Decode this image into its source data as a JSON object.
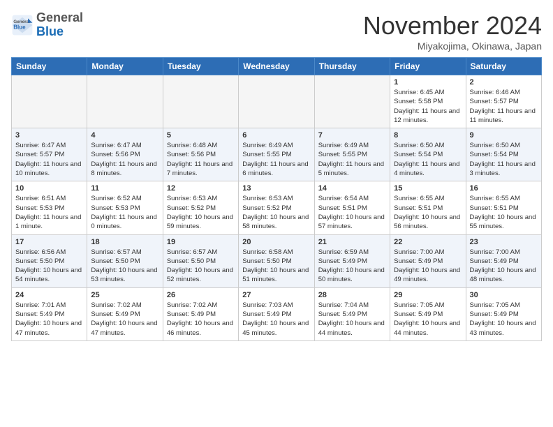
{
  "header": {
    "logo": {
      "general": "General",
      "blue": "Blue"
    },
    "title": "November 2024",
    "location": "Miyakojima, Okinawa, Japan"
  },
  "weekdays": [
    "Sunday",
    "Monday",
    "Tuesday",
    "Wednesday",
    "Thursday",
    "Friday",
    "Saturday"
  ],
  "weeks": [
    [
      {
        "day": null
      },
      {
        "day": null
      },
      {
        "day": null
      },
      {
        "day": null
      },
      {
        "day": null
      },
      {
        "day": 1,
        "sunrise": "Sunrise: 6:45 AM",
        "sunset": "Sunset: 5:58 PM",
        "daylight": "Daylight: 11 hours and 12 minutes."
      },
      {
        "day": 2,
        "sunrise": "Sunrise: 6:46 AM",
        "sunset": "Sunset: 5:57 PM",
        "daylight": "Daylight: 11 hours and 11 minutes."
      }
    ],
    [
      {
        "day": 3,
        "sunrise": "Sunrise: 6:47 AM",
        "sunset": "Sunset: 5:57 PM",
        "daylight": "Daylight: 11 hours and 10 minutes."
      },
      {
        "day": 4,
        "sunrise": "Sunrise: 6:47 AM",
        "sunset": "Sunset: 5:56 PM",
        "daylight": "Daylight: 11 hours and 8 minutes."
      },
      {
        "day": 5,
        "sunrise": "Sunrise: 6:48 AM",
        "sunset": "Sunset: 5:56 PM",
        "daylight": "Daylight: 11 hours and 7 minutes."
      },
      {
        "day": 6,
        "sunrise": "Sunrise: 6:49 AM",
        "sunset": "Sunset: 5:55 PM",
        "daylight": "Daylight: 11 hours and 6 minutes."
      },
      {
        "day": 7,
        "sunrise": "Sunrise: 6:49 AM",
        "sunset": "Sunset: 5:55 PM",
        "daylight": "Daylight: 11 hours and 5 minutes."
      },
      {
        "day": 8,
        "sunrise": "Sunrise: 6:50 AM",
        "sunset": "Sunset: 5:54 PM",
        "daylight": "Daylight: 11 hours and 4 minutes."
      },
      {
        "day": 9,
        "sunrise": "Sunrise: 6:50 AM",
        "sunset": "Sunset: 5:54 PM",
        "daylight": "Daylight: 11 hours and 3 minutes."
      }
    ],
    [
      {
        "day": 10,
        "sunrise": "Sunrise: 6:51 AM",
        "sunset": "Sunset: 5:53 PM",
        "daylight": "Daylight: 11 hours and 1 minute."
      },
      {
        "day": 11,
        "sunrise": "Sunrise: 6:52 AM",
        "sunset": "Sunset: 5:53 PM",
        "daylight": "Daylight: 11 hours and 0 minutes."
      },
      {
        "day": 12,
        "sunrise": "Sunrise: 6:53 AM",
        "sunset": "Sunset: 5:52 PM",
        "daylight": "Daylight: 10 hours and 59 minutes."
      },
      {
        "day": 13,
        "sunrise": "Sunrise: 6:53 AM",
        "sunset": "Sunset: 5:52 PM",
        "daylight": "Daylight: 10 hours and 58 minutes."
      },
      {
        "day": 14,
        "sunrise": "Sunrise: 6:54 AM",
        "sunset": "Sunset: 5:51 PM",
        "daylight": "Daylight: 10 hours and 57 minutes."
      },
      {
        "day": 15,
        "sunrise": "Sunrise: 6:55 AM",
        "sunset": "Sunset: 5:51 PM",
        "daylight": "Daylight: 10 hours and 56 minutes."
      },
      {
        "day": 16,
        "sunrise": "Sunrise: 6:55 AM",
        "sunset": "Sunset: 5:51 PM",
        "daylight": "Daylight: 10 hours and 55 minutes."
      }
    ],
    [
      {
        "day": 17,
        "sunrise": "Sunrise: 6:56 AM",
        "sunset": "Sunset: 5:50 PM",
        "daylight": "Daylight: 10 hours and 54 minutes."
      },
      {
        "day": 18,
        "sunrise": "Sunrise: 6:57 AM",
        "sunset": "Sunset: 5:50 PM",
        "daylight": "Daylight: 10 hours and 53 minutes."
      },
      {
        "day": 19,
        "sunrise": "Sunrise: 6:57 AM",
        "sunset": "Sunset: 5:50 PM",
        "daylight": "Daylight: 10 hours and 52 minutes."
      },
      {
        "day": 20,
        "sunrise": "Sunrise: 6:58 AM",
        "sunset": "Sunset: 5:50 PM",
        "daylight": "Daylight: 10 hours and 51 minutes."
      },
      {
        "day": 21,
        "sunrise": "Sunrise: 6:59 AM",
        "sunset": "Sunset: 5:49 PM",
        "daylight": "Daylight: 10 hours and 50 minutes."
      },
      {
        "day": 22,
        "sunrise": "Sunrise: 7:00 AM",
        "sunset": "Sunset: 5:49 PM",
        "daylight": "Daylight: 10 hours and 49 minutes."
      },
      {
        "day": 23,
        "sunrise": "Sunrise: 7:00 AM",
        "sunset": "Sunset: 5:49 PM",
        "daylight": "Daylight: 10 hours and 48 minutes."
      }
    ],
    [
      {
        "day": 24,
        "sunrise": "Sunrise: 7:01 AM",
        "sunset": "Sunset: 5:49 PM",
        "daylight": "Daylight: 10 hours and 47 minutes."
      },
      {
        "day": 25,
        "sunrise": "Sunrise: 7:02 AM",
        "sunset": "Sunset: 5:49 PM",
        "daylight": "Daylight: 10 hours and 47 minutes."
      },
      {
        "day": 26,
        "sunrise": "Sunrise: 7:02 AM",
        "sunset": "Sunset: 5:49 PM",
        "daylight": "Daylight: 10 hours and 46 minutes."
      },
      {
        "day": 27,
        "sunrise": "Sunrise: 7:03 AM",
        "sunset": "Sunset: 5:49 PM",
        "daylight": "Daylight: 10 hours and 45 minutes."
      },
      {
        "day": 28,
        "sunrise": "Sunrise: 7:04 AM",
        "sunset": "Sunset: 5:49 PM",
        "daylight": "Daylight: 10 hours and 44 minutes."
      },
      {
        "day": 29,
        "sunrise": "Sunrise: 7:05 AM",
        "sunset": "Sunset: 5:49 PM",
        "daylight": "Daylight: 10 hours and 44 minutes."
      },
      {
        "day": 30,
        "sunrise": "Sunrise: 7:05 AM",
        "sunset": "Sunset: 5:49 PM",
        "daylight": "Daylight: 10 hours and 43 minutes."
      }
    ]
  ]
}
